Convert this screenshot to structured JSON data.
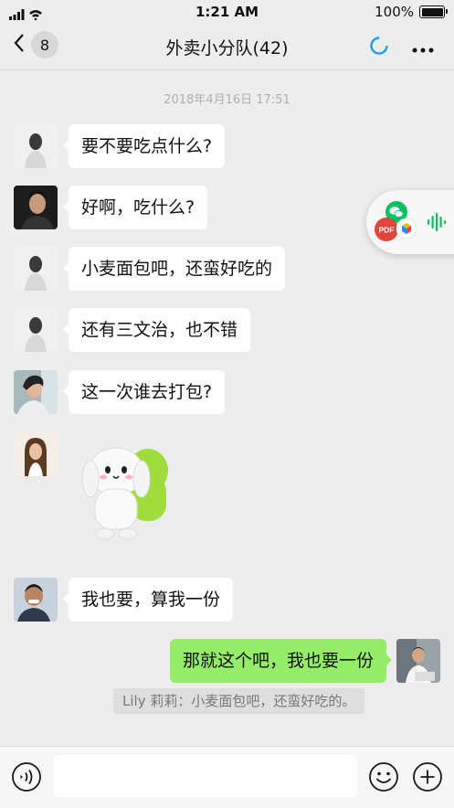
{
  "status_bar": {
    "time": "1:21 AM",
    "battery": "100%"
  },
  "nav": {
    "back_count": "8",
    "title": "外卖小分队(42)"
  },
  "timestamp": "2018年4月16日 17:51",
  "messages": [
    {
      "text": "要不要吃点什么?"
    },
    {
      "text": "好啊，吃什么?"
    },
    {
      "text": "小麦面包吧，还蛮好吃的"
    },
    {
      "text": "还有三文治，也不错"
    },
    {
      "text": "这一次谁去打包?"
    },
    {
      "sticker": "dog-sticker"
    },
    {
      "text": "我也要，算我一份"
    },
    {
      "text": "那就这个吧，我也要一份"
    }
  ],
  "quote": "Lily 莉莉：小麦面包吧，还蛮好吃的。",
  "floating_pdf_label": "PDF",
  "colors": {
    "background": "#ededed",
    "self_bubble": "#95ec69",
    "wechat_green": "#07c160",
    "spinner_blue": "#1aa1f3"
  }
}
